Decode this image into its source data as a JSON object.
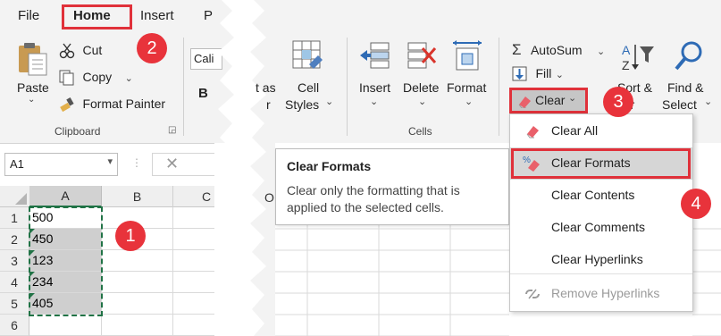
{
  "tabs": {
    "file": "File",
    "home": "Home",
    "insert": "Insert",
    "partial": "P"
  },
  "clipboard": {
    "paste": "Paste",
    "cut": "Cut",
    "copy": "Copy",
    "format_painter": "Format Painter",
    "group_label": "Clipboard"
  },
  "font": {
    "font_box": "Cali",
    "bold": "B"
  },
  "styles": {
    "partial_top": "t as",
    "partial_bottom": "r",
    "cell_styles_1": "Cell",
    "cell_styles_2": "Styles"
  },
  "cells": {
    "insert": "Insert",
    "delete": "Delete",
    "format": "Format",
    "group_label": "Cells"
  },
  "editing": {
    "autosum": "AutoSum",
    "fill": "Fill",
    "clear": "Clear",
    "sort_1": "Sort &",
    "sort_2": "ter",
    "find_1": "Find &",
    "find_2": "Select"
  },
  "formula_bar": {
    "name_box": "A1"
  },
  "sheet": {
    "columns": [
      "A",
      "B",
      "C",
      "O"
    ],
    "rows": [
      "1",
      "2",
      "3",
      "4",
      "5",
      "6"
    ],
    "values": [
      "500",
      "450",
      "123",
      "234",
      "405"
    ]
  },
  "tooltip": {
    "title": "Clear Formats",
    "body_1": "Clear only the formatting that is",
    "body_2": "applied to the selected cells."
  },
  "clear_menu": {
    "items": [
      "Clear All",
      "Clear Formats",
      "Clear Contents",
      "Clear Comments",
      "Clear Hyperlinks",
      "Remove Hyperlinks"
    ]
  },
  "badges": {
    "one": "1",
    "two": "2",
    "three": "3",
    "four": "4"
  },
  "colors": {
    "accent_red": "#e0313a",
    "excel_green": "#217346",
    "selection_gray": "#cfcfcf"
  }
}
